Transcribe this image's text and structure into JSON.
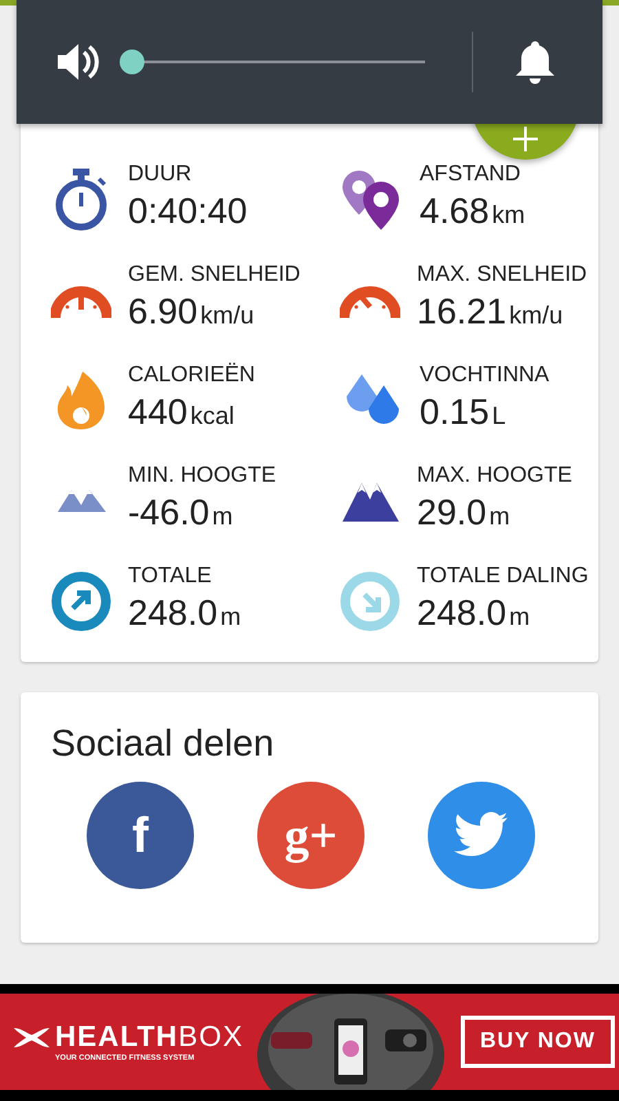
{
  "volume_panel": {
    "level": 0.0
  },
  "summary": {
    "stats": [
      {
        "kind": "stopwatch",
        "label": "DUUR",
        "value": "0:40:40"
      },
      {
        "kind": "pins",
        "label": "AFSTAND",
        "value": "4.68",
        "unit": "km"
      },
      {
        "kind": "gauge-avg",
        "label": "GEM. SNELHEID",
        "value": "6.90",
        "unit": "km/u"
      },
      {
        "kind": "gauge-max",
        "label": "MAX. SNELHEID",
        "value": "16.21",
        "unit": "km/u"
      },
      {
        "kind": "flame",
        "label": "CALORIEËN",
        "value": "440",
        "unit": "kcal"
      },
      {
        "kind": "drops",
        "label": "VOCHTINNA",
        "value": "0.15",
        "unit": "L"
      },
      {
        "kind": "mountain-low",
        "label": "MIN. HOOGTE",
        "value": "-46.0",
        "unit": "m"
      },
      {
        "kind": "mountain-high",
        "label": "MAX. HOOGTE",
        "value": "29.0",
        "unit": "m"
      },
      {
        "kind": "ascent",
        "label": "TOTALE",
        "value": "248.0",
        "unit": "m"
      },
      {
        "kind": "descent",
        "label": "TOTALE DALING",
        "value": "248.0",
        "unit": "m"
      }
    ]
  },
  "social": {
    "title": "Sociaal delen",
    "buttons": [
      {
        "kind": "facebook",
        "glyph": "f"
      },
      {
        "kind": "googleplus",
        "glyph": "g+"
      },
      {
        "kind": "twitter"
      }
    ]
  },
  "ad": {
    "brand_bold": "HEALTH",
    "brand_light": "BOX",
    "tagline": "YOUR CONNECTED FITNESS SYSTEM",
    "cta": "BUY NOW"
  }
}
